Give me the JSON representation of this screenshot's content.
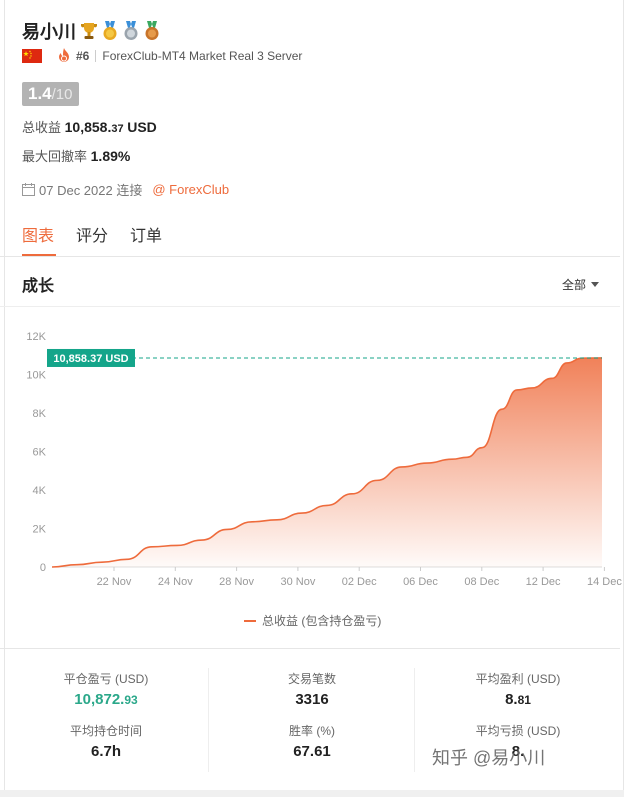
{
  "profile": {
    "name": "易小川",
    "rank": "#6",
    "server": "ForexClub-MT4 Market Real 3 Server",
    "score_value": "1.4",
    "score_max": "/10",
    "total_profit_label": "总收益",
    "total_profit_main": "10,858.",
    "total_profit_cents": "37",
    "total_profit_currency": "USD",
    "drawdown_label": "最大回撤率",
    "drawdown_value": "1.89%",
    "connected_date": "07 Dec 2022 连接",
    "broker_link": "@ ForexClub"
  },
  "tabs": [
    {
      "label": "图表",
      "active": true
    },
    {
      "label": "评分",
      "active": false
    },
    {
      "label": "订单",
      "active": false
    }
  ],
  "growth": {
    "title": "成长",
    "filter_label": "全部"
  },
  "colors": {
    "accent": "#ee6b3c",
    "teal": "#14a58a",
    "positive": "#2ba88a"
  },
  "chart_data": {
    "type": "area",
    "y_ticks": [
      "0",
      "2K",
      "4K",
      "6K",
      "8K",
      "10K",
      "12K"
    ],
    "ylim": [
      0,
      12000
    ],
    "x_ticks": [
      "22 Nov",
      "24 Nov",
      "28 Nov",
      "30 Nov",
      "02 Dec",
      "06 Dec",
      "08 Dec",
      "12 Dec",
      "14 Dec"
    ],
    "current_value_label": "10,858.37 USD",
    "current_value": 10858.37,
    "legend": "总收益 (包含持仓盈亏)",
    "points": [
      [
        0,
        0
      ],
      [
        0.5,
        120
      ],
      [
        1,
        250
      ],
      [
        1.5,
        400
      ],
      [
        2,
        1050
      ],
      [
        2.5,
        1120
      ],
      [
        3,
        1400
      ],
      [
        3.5,
        1950
      ],
      [
        4,
        2350
      ],
      [
        4.5,
        2450
      ],
      [
        5,
        2800
      ],
      [
        5.5,
        3200
      ],
      [
        6,
        3800
      ],
      [
        6.5,
        4500
      ],
      [
        7,
        5200
      ],
      [
        7.5,
        5400
      ],
      [
        8,
        5600
      ],
      [
        8.3,
        5700
      ],
      [
        8.6,
        6200
      ],
      [
        9,
        8200
      ],
      [
        9.3,
        9200
      ],
      [
        9.6,
        9300
      ],
      [
        10,
        9800
      ],
      [
        10.3,
        10600
      ],
      [
        10.6,
        10850
      ],
      [
        11,
        10858.37
      ]
    ]
  },
  "stats": [
    {
      "label": "平仓盈亏 (USD)",
      "main": "10,872.",
      "cents": "93",
      "green": true
    },
    {
      "label": "交易笔数",
      "main": "3316",
      "cents": "",
      "green": false
    },
    {
      "label": "平均盈利 (USD)",
      "main": "8.",
      "cents": "81",
      "green": false
    },
    {
      "label": "平均持仓时间",
      "main": "6.7h",
      "cents": "",
      "green": false
    },
    {
      "label": "胜率 (%)",
      "main": "67.61",
      "cents": "",
      "green": false
    },
    {
      "label": "平均亏损 (USD)",
      "main": "8.",
      "cents": "",
      "green": false
    }
  ],
  "watermark": "知乎 @易小川"
}
